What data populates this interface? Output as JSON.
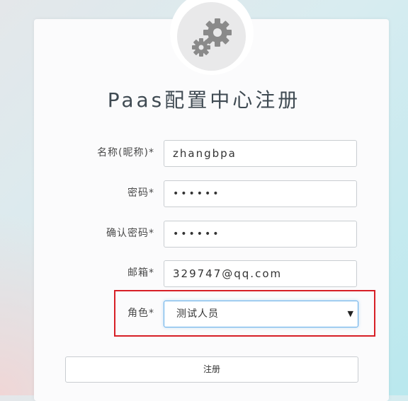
{
  "title": "Paas配置中心注册",
  "logo_icon": "gears-icon",
  "form": {
    "name_label": "名称(昵称)*",
    "name_value": "zhangbpa",
    "password_label": "密码*",
    "password_value": "••••••",
    "confirm_label": "确认密码*",
    "confirm_value": "••••••",
    "email_label": "邮箱*",
    "email_value": "329747@qq.com",
    "role_label": "角色*",
    "role_value": "测试人员",
    "role_arrow": "▼",
    "submit_label": "注册"
  },
  "colors": {
    "highlight_border": "#d71f26",
    "focus_border": "#66afe9"
  }
}
